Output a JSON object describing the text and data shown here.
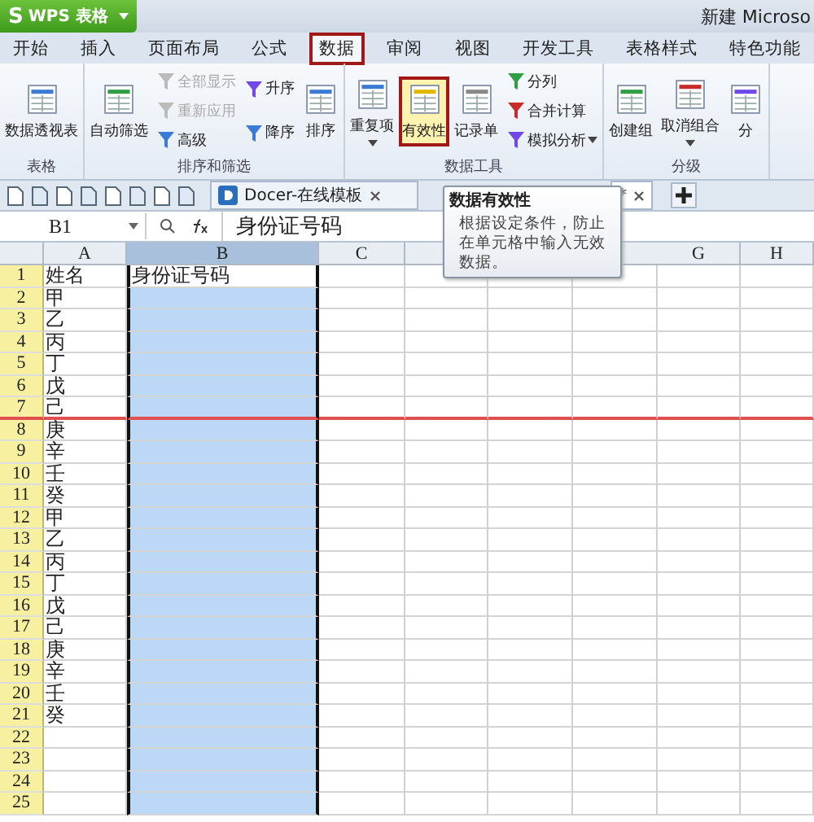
{
  "app_button": {
    "logo": "S",
    "label": "WPS 表格"
  },
  "window_title": "新建 Microso",
  "tabs": [
    {
      "label": "开始",
      "selected": false,
      "highlighted": false
    },
    {
      "label": "插入",
      "selected": false,
      "highlighted": false
    },
    {
      "label": "页面布局",
      "selected": false,
      "highlighted": false
    },
    {
      "label": "公式",
      "selected": false,
      "highlighted": false
    },
    {
      "label": "数据",
      "selected": true,
      "highlighted": true
    },
    {
      "label": "审阅",
      "selected": false,
      "highlighted": false
    },
    {
      "label": "视图",
      "selected": false,
      "highlighted": false
    },
    {
      "label": "开发工具",
      "selected": false,
      "highlighted": false
    },
    {
      "label": "表格样式",
      "selected": false,
      "highlighted": false
    },
    {
      "label": "特色功能",
      "selected": false,
      "highlighted": false
    }
  ],
  "ribbon_groups": [
    {
      "label": "表格",
      "columns": [
        [
          {
            "kind": "large",
            "label": "数据透视表",
            "disabled": false,
            "highlighted": false,
            "dropdown": false
          }
        ]
      ]
    },
    {
      "label": "排序和筛选",
      "columns": [
        [
          {
            "kind": "large",
            "label": "自动筛选",
            "disabled": false,
            "highlighted": false,
            "dropdown": false
          }
        ],
        [
          {
            "kind": "small",
            "label": "全部显示",
            "disabled": true,
            "highlighted": false,
            "dropdown": false
          },
          {
            "kind": "small",
            "label": "重新应用",
            "disabled": true,
            "highlighted": false,
            "dropdown": false
          },
          {
            "kind": "small",
            "label": "高级",
            "disabled": false,
            "highlighted": false,
            "dropdown": false
          }
        ],
        [
          {
            "kind": "small",
            "label": "升序",
            "disabled": false,
            "highlighted": false,
            "dropdown": false
          },
          {
            "kind": "small",
            "label": "降序",
            "disabled": false,
            "highlighted": false,
            "dropdown": false
          }
        ],
        [
          {
            "kind": "large",
            "label": "排序",
            "disabled": false,
            "highlighted": false,
            "dropdown": false
          }
        ]
      ]
    },
    {
      "label": "数据工具",
      "columns": [
        [
          {
            "kind": "large",
            "label": "重复项",
            "disabled": false,
            "highlighted": false,
            "dropdown": true
          }
        ],
        [
          {
            "kind": "large",
            "label": "有效性",
            "disabled": false,
            "highlighted": true,
            "dropdown": false
          }
        ],
        [
          {
            "kind": "large",
            "label": "记录单",
            "disabled": false,
            "highlighted": false,
            "dropdown": false
          }
        ],
        [
          {
            "kind": "small",
            "label": "分列",
            "disabled": false,
            "highlighted": false,
            "dropdown": false
          },
          {
            "kind": "small",
            "label": "合并计算",
            "disabled": false,
            "highlighted": false,
            "dropdown": false
          },
          {
            "kind": "small",
            "label": "模拟分析",
            "disabled": false,
            "highlighted": false,
            "dropdown": true
          }
        ]
      ]
    },
    {
      "label": "分级",
      "columns": [
        [
          {
            "kind": "large",
            "label": "创建组",
            "disabled": false,
            "highlighted": false,
            "dropdown": false
          }
        ],
        [
          {
            "kind": "large",
            "label": "取消组合",
            "disabled": false,
            "highlighted": false,
            "dropdown": true
          }
        ],
        [
          {
            "kind": "large",
            "label": "分",
            "disabled": false,
            "highlighted": false,
            "dropdown": false
          }
        ]
      ]
    }
  ],
  "doc_tabs": [
    {
      "label": "Docer-在线模板",
      "selected": false
    },
    {
      "label": "*",
      "selected": true
    }
  ],
  "formula_bar": {
    "cell": "B1",
    "value": "身份证号码"
  },
  "tooltip": {
    "title": "数据有效性",
    "text": "根据设定条件，防止在单元格中输入无效数据。"
  },
  "columns": [
    {
      "label": "A",
      "selected": false
    },
    {
      "label": "B",
      "selected": true
    },
    {
      "label": "C",
      "selected": false
    },
    {
      "selected": false
    },
    {
      "selected": false
    },
    {
      "selected": false
    },
    {
      "label": "G",
      "selected": false
    },
    {
      "label": "H",
      "selected": false
    }
  ],
  "rows": [
    {
      "number": "1",
      "cells": [
        "姓名",
        "身份证号码"
      ],
      "active": true,
      "marked": false
    },
    {
      "number": "2",
      "cells": [
        "甲"
      ],
      "active": false,
      "marked": false
    },
    {
      "number": "3",
      "cells": [
        "乙"
      ],
      "active": false,
      "marked": false
    },
    {
      "number": "4",
      "cells": [
        "丙"
      ],
      "active": false,
      "marked": false
    },
    {
      "number": "5",
      "cells": [
        "丁"
      ],
      "active": false,
      "marked": false
    },
    {
      "number": "6",
      "cells": [
        "戊"
      ],
      "active": false,
      "marked": false
    },
    {
      "number": "7",
      "cells": [
        "己"
      ],
      "active": false,
      "marked": true
    },
    {
      "number": "8",
      "cells": [
        "庚"
      ],
      "active": false,
      "marked": false
    },
    {
      "number": "9",
      "cells": [
        "辛"
      ],
      "active": false,
      "marked": false
    },
    {
      "number": "10",
      "cells": [
        "壬"
      ],
      "active": false,
      "marked": false
    },
    {
      "number": "11",
      "cells": [
        "癸"
      ],
      "active": false,
      "marked": false
    },
    {
      "number": "12",
      "cells": [
        "甲"
      ],
      "active": false,
      "marked": false
    },
    {
      "number": "13",
      "cells": [
        "乙"
      ],
      "active": false,
      "marked": false
    },
    {
      "number": "14",
      "cells": [
        "丙"
      ],
      "active": false,
      "marked": false
    },
    {
      "number": "15",
      "cells": [
        "丁"
      ],
      "active": false,
      "marked": false
    },
    {
      "number": "16",
      "cells": [
        "戊"
      ],
      "active": false,
      "marked": false
    },
    {
      "number": "17",
      "cells": [
        "己"
      ],
      "active": false,
      "marked": false
    },
    {
      "number": "18",
      "cells": [
        "庚"
      ],
      "active": false,
      "marked": false
    },
    {
      "number": "19",
      "cells": [
        "辛"
      ],
      "active": false,
      "marked": false
    },
    {
      "number": "20",
      "cells": [
        "壬"
      ],
      "active": false,
      "marked": false
    },
    {
      "number": "21",
      "cells": [
        "癸"
      ],
      "active": false,
      "marked": false
    },
    {
      "number": "22",
      "cells": [],
      "active": false,
      "marked": false
    },
    {
      "number": "23",
      "cells": [],
      "active": false,
      "marked": false
    },
    {
      "number": "24",
      "cells": [],
      "active": false,
      "marked": false
    },
    {
      "number": "25",
      "cells": [],
      "active": false,
      "marked": false
    }
  ]
}
